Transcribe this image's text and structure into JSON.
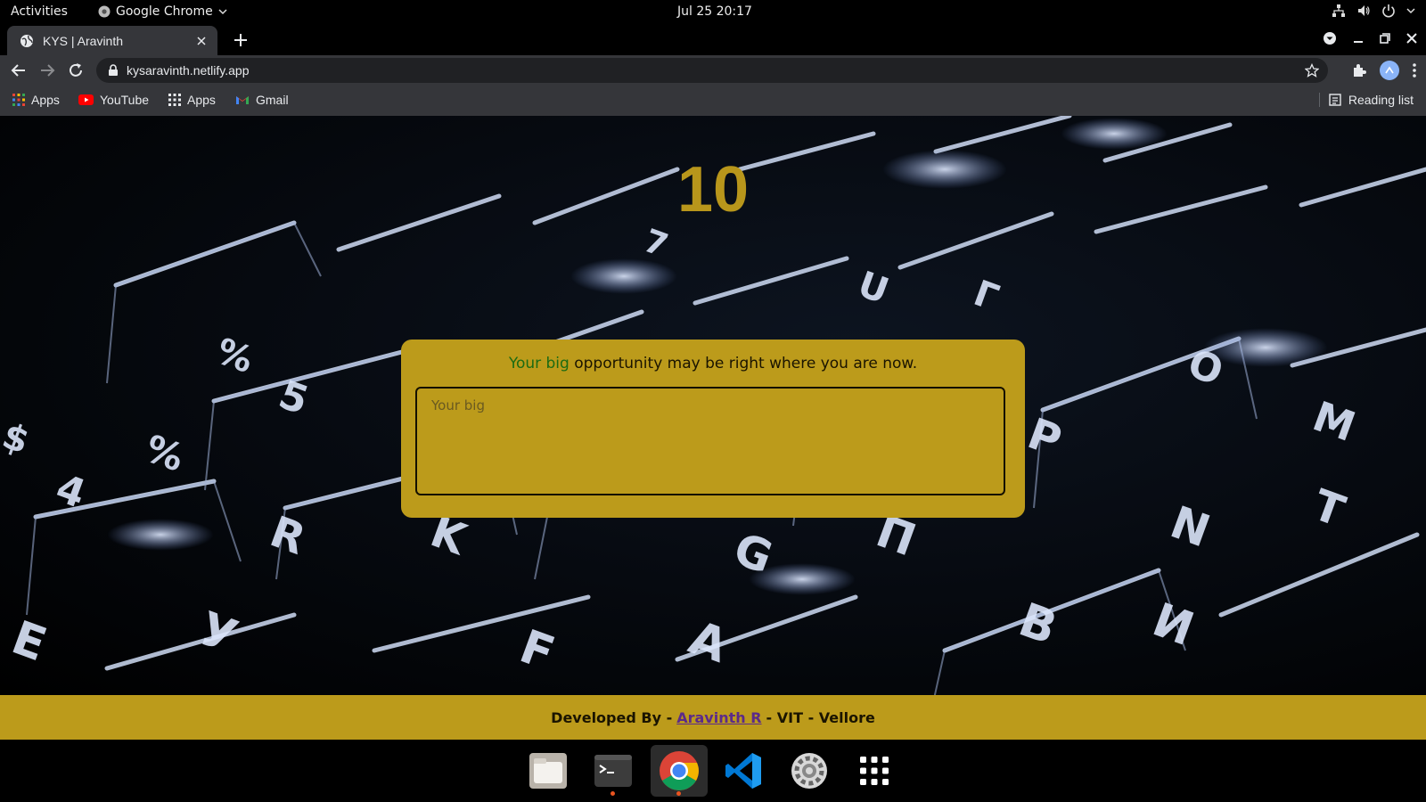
{
  "topbar": {
    "activities": "Activities",
    "app_name": "Google Chrome",
    "clock": "Jul 25  20:17"
  },
  "browser": {
    "tab_title": "KYS | Aravinth",
    "url": "kysaravinth.netlify.app",
    "bookmarks": [
      {
        "label": "Apps",
        "icon": "apps-grid-icon"
      },
      {
        "label": "YouTube",
        "icon": "youtube-icon"
      },
      {
        "label": "Apps",
        "icon": "apps-grid-icon"
      },
      {
        "label": "Gmail",
        "icon": "gmail-icon"
      }
    ],
    "reading_list": "Reading list"
  },
  "page": {
    "counter": "10",
    "quote_typed": "Your big",
    "quote_rest": " opportunity may be right where you are now.",
    "input_text": "Your big",
    "footer_prefix": "Developed By -",
    "footer_link": "Aravinth R",
    "footer_suffix": "- VIT - Vellore"
  },
  "colors": {
    "accent_gold": "#bc9b1b",
    "typed_green": "#1c6b12",
    "footer_link": "#5b2a8a"
  },
  "dock": [
    {
      "name": "files-icon",
      "running": false
    },
    {
      "name": "terminal-icon",
      "running": true
    },
    {
      "name": "chrome-icon",
      "running": true,
      "active": true
    },
    {
      "name": "vscode-icon",
      "running": false
    },
    {
      "name": "settings-icon",
      "running": false
    },
    {
      "name": "show-apps-icon",
      "running": false
    }
  ]
}
